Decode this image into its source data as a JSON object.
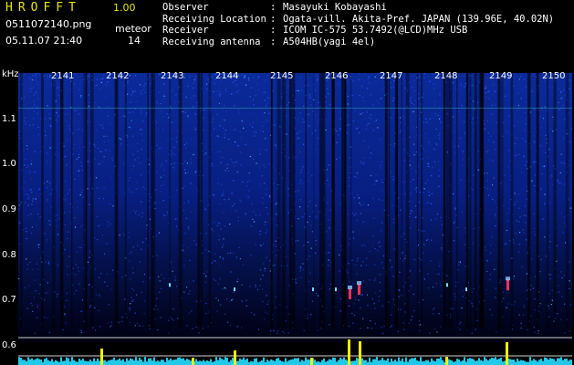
{
  "app": {
    "name": "HROFFT",
    "version": "1.00"
  },
  "file": {
    "name": "0511072140.png",
    "datetime": "05.11.07 21:40"
  },
  "meteor": {
    "label": "meteor",
    "count": "14"
  },
  "station": [
    {
      "key": "Observer",
      "value": "Masayuki Kobayashi"
    },
    {
      "key": "Receiving Location",
      "value": "Ogata-vill. Akita-Pref. JAPAN (139.96E, 40.02N)"
    },
    {
      "key": "Receiver",
      "value": "ICOM IC-575 53.7492(@LCD)MHz USB"
    },
    {
      "key": "Receiving antenna",
      "value": "A504HB(yagi 4el)"
    }
  ],
  "chart_data": {
    "type": "heatmap",
    "title": "",
    "ylabel": "kHz",
    "y_ticks": [
      "1.1",
      "1.0",
      "0.9",
      "0.8",
      "0.7",
      "0.6"
    ],
    "x_ticks": [
      "2141",
      "2142",
      "2143",
      "2144",
      "2145",
      "2146",
      "2147",
      "2148",
      "2149",
      "2150"
    ],
    "ylim": [
      0.58,
      1.2
    ],
    "meteor_echoes_khz": [
      0.7,
      0.71,
      0.72
    ]
  }
}
